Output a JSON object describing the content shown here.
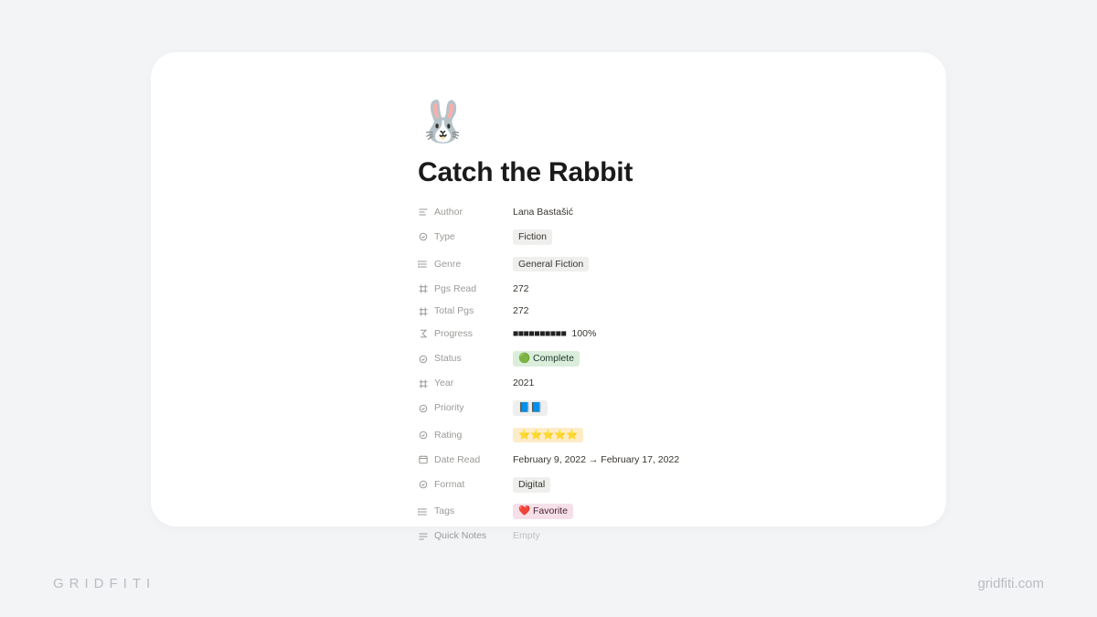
{
  "page": {
    "icon": "🐰",
    "title": "Catch the Rabbit"
  },
  "properties": {
    "author": {
      "label": "Author",
      "value": "Lana Bastašić"
    },
    "type": {
      "label": "Type",
      "value": "Fiction"
    },
    "genre": {
      "label": "Genre",
      "value": "General Fiction"
    },
    "pgs_read": {
      "label": "Pgs Read",
      "value": "272"
    },
    "total_pgs": {
      "label": "Total Pgs",
      "value": "272"
    },
    "progress": {
      "label": "Progress",
      "bar": "■■■■■■■■■■",
      "pct": "100%"
    },
    "status": {
      "label": "Status",
      "value": "🟢 Complete"
    },
    "year": {
      "label": "Year",
      "value": "2021"
    },
    "priority": {
      "label": "Priority",
      "value": "📘📘"
    },
    "rating": {
      "label": "Rating",
      "value": "⭐️⭐️⭐️⭐️⭐️"
    },
    "date_read": {
      "label": "Date Read",
      "value": "February 9, 2022 → February 17, 2022"
    },
    "format": {
      "label": "Format",
      "value": "Digital"
    },
    "tags": {
      "label": "Tags",
      "value": "❤️ Favorite"
    },
    "quick_notes": {
      "label": "Quick Notes",
      "value": "Empty"
    }
  },
  "footer": {
    "brand": "GRIDFITI",
    "site": "gridfiti.com"
  }
}
